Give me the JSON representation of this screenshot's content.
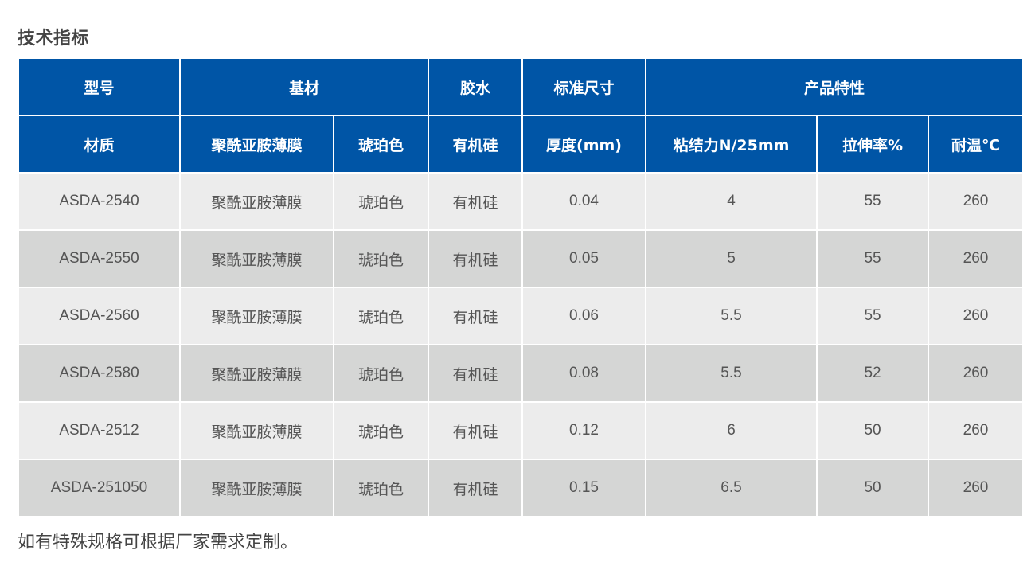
{
  "section_title": "技术指标",
  "header_row1": {
    "model": "型号",
    "substrate": "基材",
    "adhesive": "胶水",
    "standard_size": "标准尺寸",
    "product_features": "产品特性"
  },
  "header_row2": {
    "material": "材质",
    "film": "聚酰亚胺薄膜",
    "color": "琥珀色",
    "glue": "有机硅",
    "thickness": "厚度(mm)",
    "adhesion": "粘结力N/25mm",
    "elongation": "拉伸率%",
    "temperature": "耐温℃"
  },
  "rows": [
    {
      "model": "ASDA-2540",
      "material": "聚酰亚胺薄膜",
      "color": "琥珀色",
      "glue": "有机硅",
      "thickness": "0.04",
      "adhesion": "4",
      "elongation": "55",
      "temperature": "260"
    },
    {
      "model": "ASDA-2550",
      "material": "聚酰亚胺薄膜",
      "color": "琥珀色",
      "glue": "有机硅",
      "thickness": "0.05",
      "adhesion": "5",
      "elongation": "55",
      "temperature": "260"
    },
    {
      "model": "ASDA-2560",
      "material": "聚酰亚胺薄膜",
      "color": "琥珀色",
      "glue": "有机硅",
      "thickness": "0.06",
      "adhesion": "5.5",
      "elongation": "55",
      "temperature": "260"
    },
    {
      "model": "ASDA-2580",
      "material": "聚酰亚胺薄膜",
      "color": "琥珀色",
      "glue": "有机硅",
      "thickness": "0.08",
      "adhesion": "5.5",
      "elongation": "52",
      "temperature": "260"
    },
    {
      "model": "ASDA-2512",
      "material": "聚酰亚胺薄膜",
      "color": "琥珀色",
      "glue": "有机硅",
      "thickness": "0.12",
      "adhesion": "6",
      "elongation": "50",
      "temperature": "260"
    },
    {
      "model": "ASDA-251050",
      "material": "聚酰亚胺薄膜",
      "color": "琥珀色",
      "glue": "有机硅",
      "thickness": "0.15",
      "adhesion": "6.5",
      "elongation": "50",
      "temperature": "260"
    }
  ],
  "footnote": "如有特殊规格可根据厂家需求定制。",
  "colors": {
    "header_blue": "#0055a6",
    "row_light": "#ececec",
    "row_dark": "#d5d6d5"
  }
}
